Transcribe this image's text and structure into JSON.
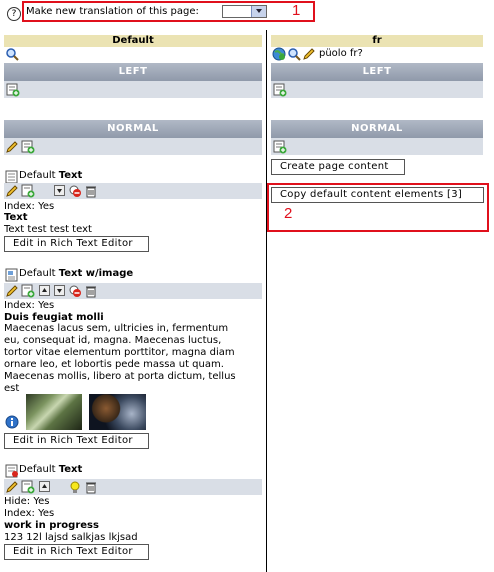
{
  "top": {
    "help_label": "?",
    "make_translation_label": "Make new translation of this page:",
    "select_value": "",
    "callout_1": "1"
  },
  "left": {
    "header": "Default",
    "section_left": "LEFT",
    "section_normal": "NORMAL",
    "elements": [
      {
        "type_prefix": "Default",
        "type_name": "Text",
        "meta": [
          "Index: Yes"
        ],
        "title": "Text",
        "body": "Text test test text",
        "edit_button": "Edit in Rich Text Editor"
      },
      {
        "type_prefix": "Default",
        "type_name": "Text w/image",
        "meta": [
          "Index: Yes"
        ],
        "title": "Duis feugiat molli",
        "body_lines": [
          "Maecenas lacus sem, ultricies in, fermentum",
          "eu, consequat id, magna. Maecenas luctus,",
          "tortor vitae elementum porttitor, magna diam",
          "ornare leo, et lobortis pede massa ut quam.",
          "Maecenas mollis, libero at porta dictum, tellus",
          "est"
        ],
        "edit_button": "Edit in Rich Text Editor"
      },
      {
        "type_prefix": "Default",
        "type_name": "Text",
        "meta": [
          "Hide: Yes",
          "Index: Yes"
        ],
        "title": "work in progress",
        "body": "123 12l lajsd salkjas lkjsad",
        "edit_button": "Edit in Rich Text Editor"
      }
    ]
  },
  "right": {
    "header": "fr",
    "language_label": "püolo fr?",
    "section_left": "LEFT",
    "section_normal": "NORMAL",
    "create_button": "Create page content",
    "copy_button": "Copy default content elements [3]",
    "callout_2": "2"
  },
  "colors": {
    "callout_red": "#e0101c",
    "column_header": "#ebe3b3",
    "section_bar": "#9aa3b3",
    "icon_row": "#d9dee6"
  }
}
